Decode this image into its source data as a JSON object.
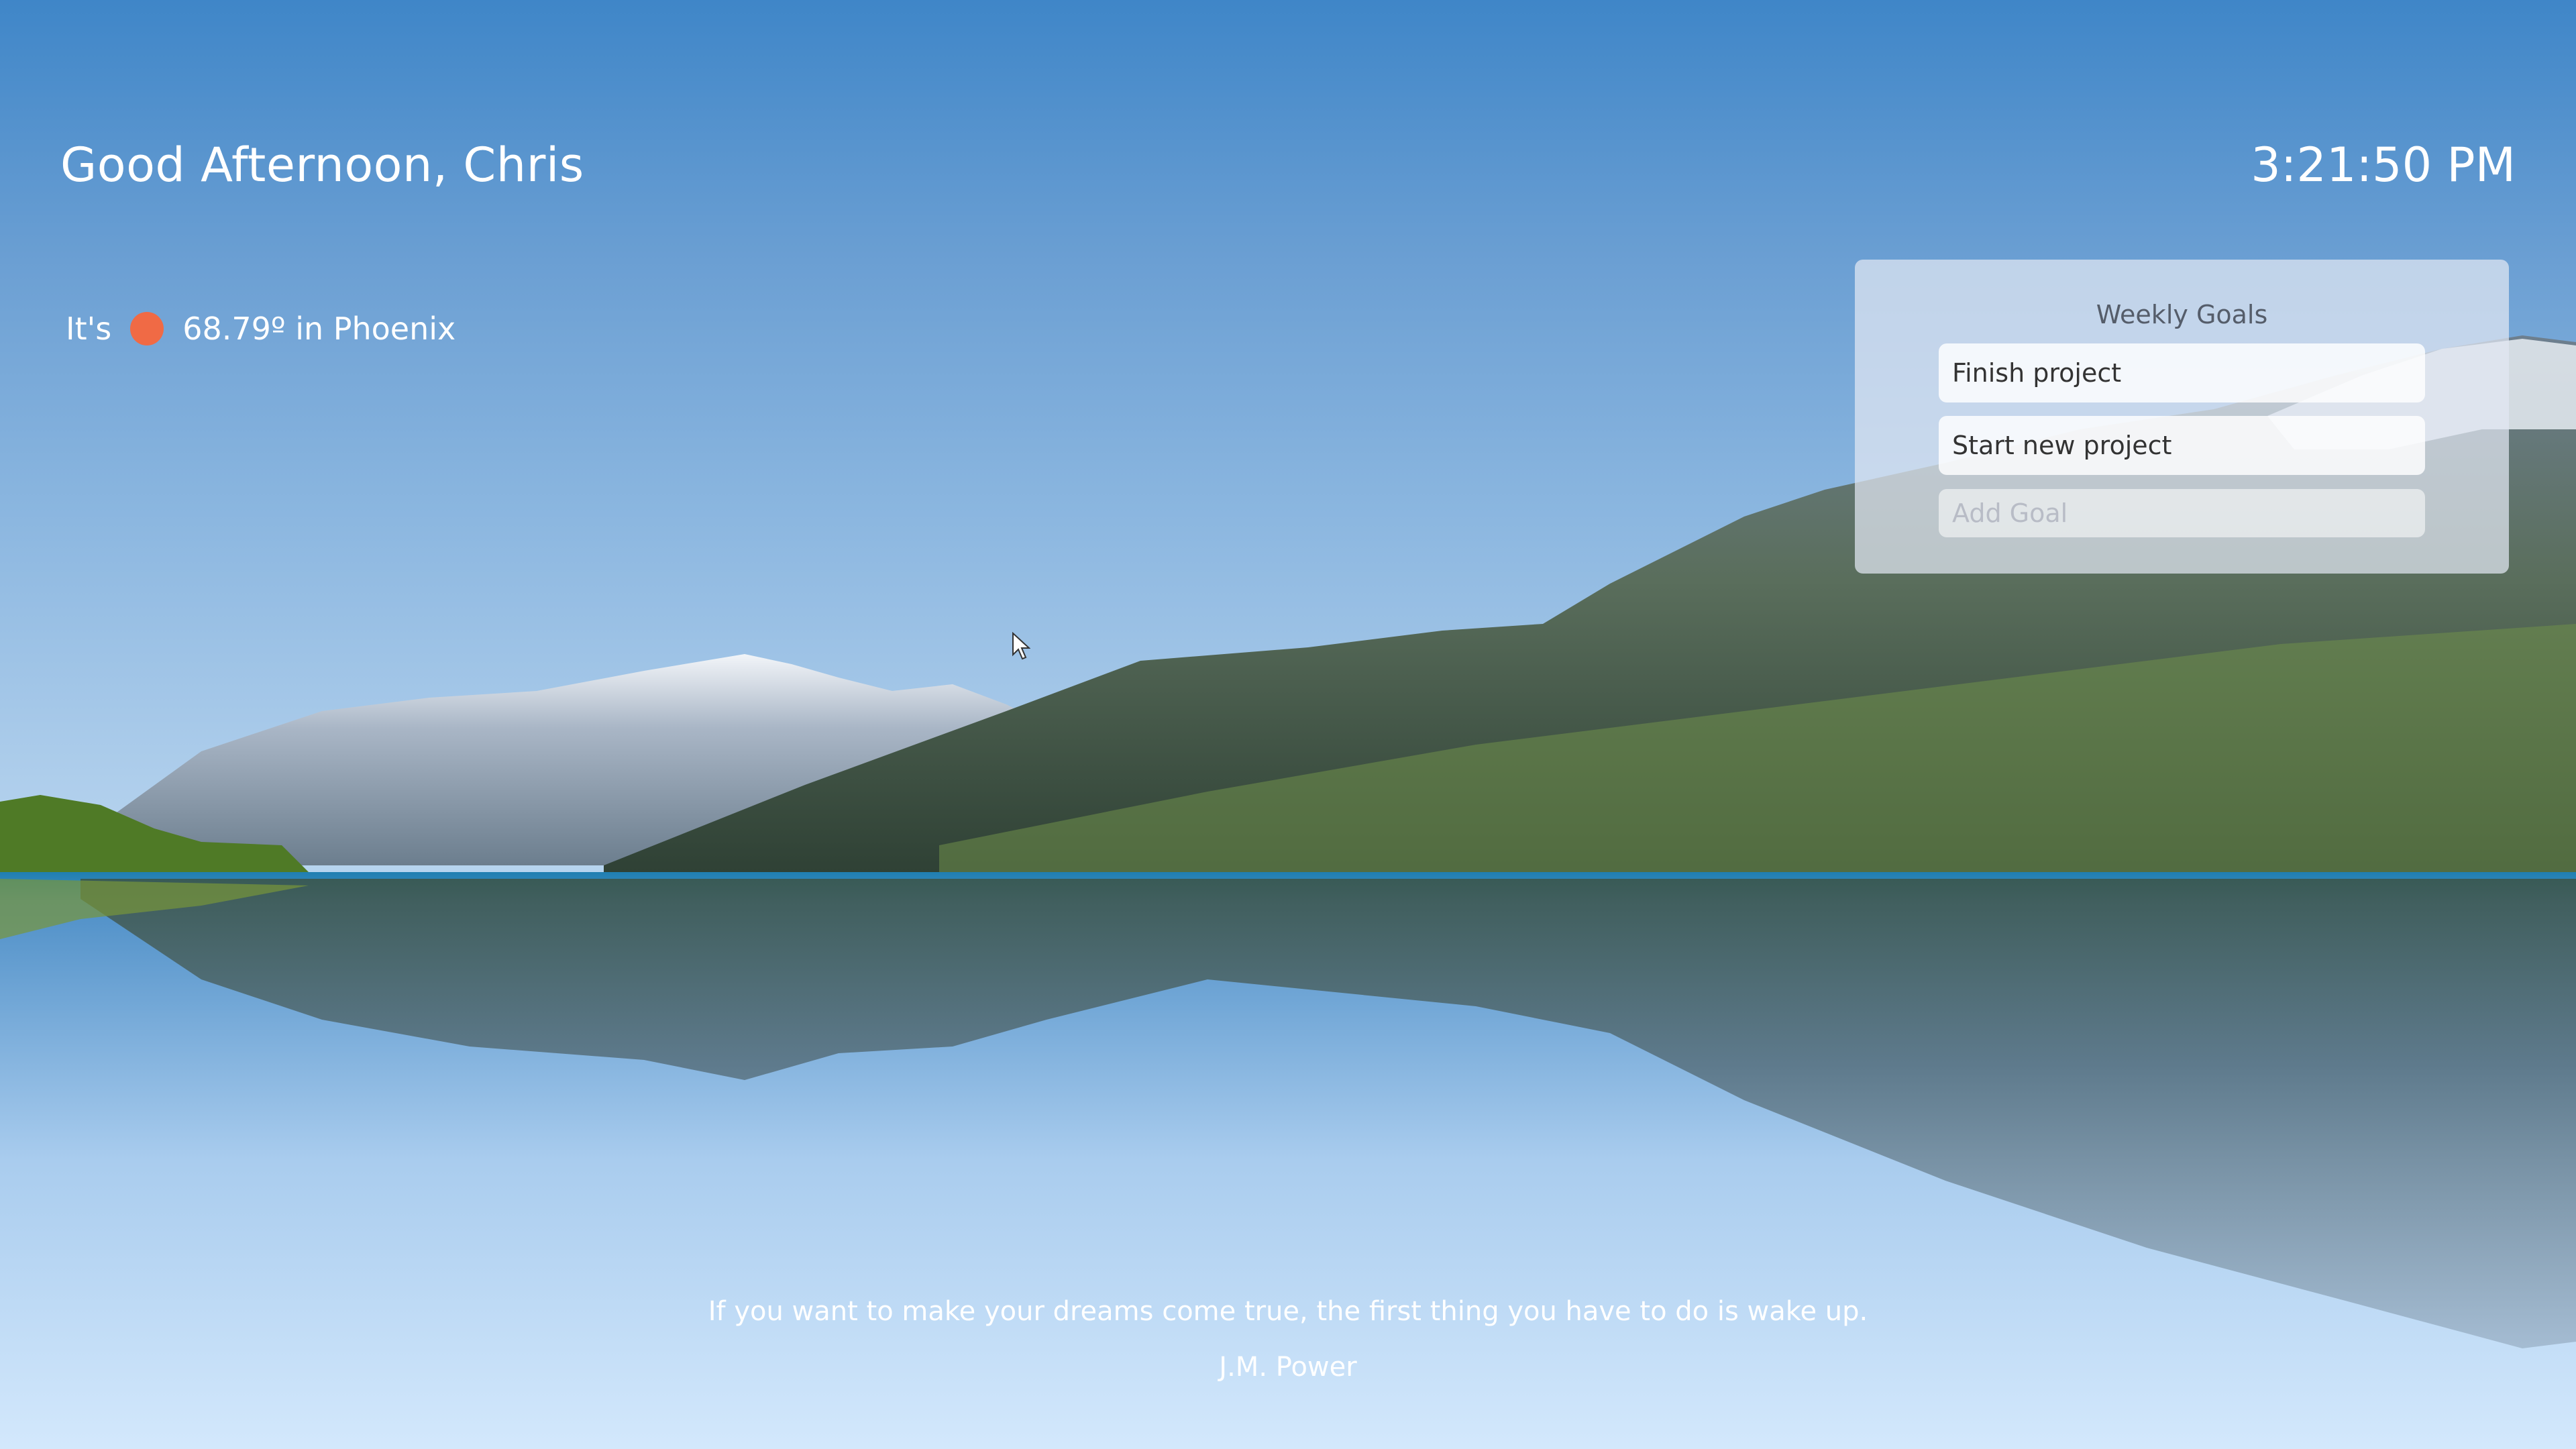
{
  "greeting": "Good Afternoon, Chris",
  "clock": "3:21:50 PM",
  "weather": {
    "prefix": "It's",
    "icon": "sun-icon",
    "icon_color": "#f06a45",
    "reading": "68.79º in Phoenix"
  },
  "goals": {
    "title": "Weekly Goals",
    "items": [
      {
        "label": "Finish project"
      },
      {
        "label": "Start new project"
      }
    ],
    "input_placeholder": "Add Goal"
  },
  "quote": {
    "text": "If you want to make your dreams come true, the first thing you have to do is wake up.",
    "author": "J.M. Power"
  }
}
